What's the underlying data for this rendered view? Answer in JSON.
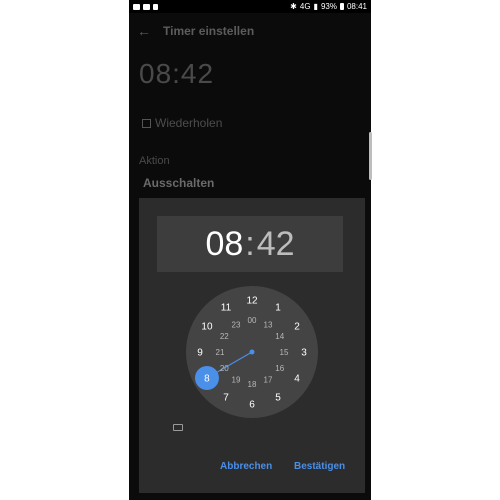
{
  "statusbar": {
    "signal_label": "4G",
    "battery_percent": "93%",
    "time": "08:41"
  },
  "appbar": {
    "back_icon": "back-arrow-icon",
    "title": "Timer einstellen"
  },
  "background": {
    "time": "08:42",
    "repeat_label": "Wiederholen",
    "aktion_label": "Aktion",
    "aktion_value": "Ausschalten"
  },
  "dialog": {
    "hour": "08",
    "separator": ":",
    "minute": "42",
    "selected_hour": "8",
    "outer_hours": [
      "12",
      "1",
      "2",
      "3",
      "4",
      "5",
      "6",
      "7",
      "8",
      "9",
      "10",
      "11"
    ],
    "inner_hours": [
      "00",
      "13",
      "14",
      "15",
      "16",
      "17",
      "18",
      "19",
      "20",
      "21",
      "22",
      "23"
    ],
    "keyboard_icon": "keyboard-icon",
    "cancel_label": "Abbrechen",
    "confirm_label": "Bestätigen"
  },
  "colors": {
    "accent": "#4a8fe8",
    "dialog_bg": "#2c2c2c",
    "clock_face": "#444444"
  }
}
